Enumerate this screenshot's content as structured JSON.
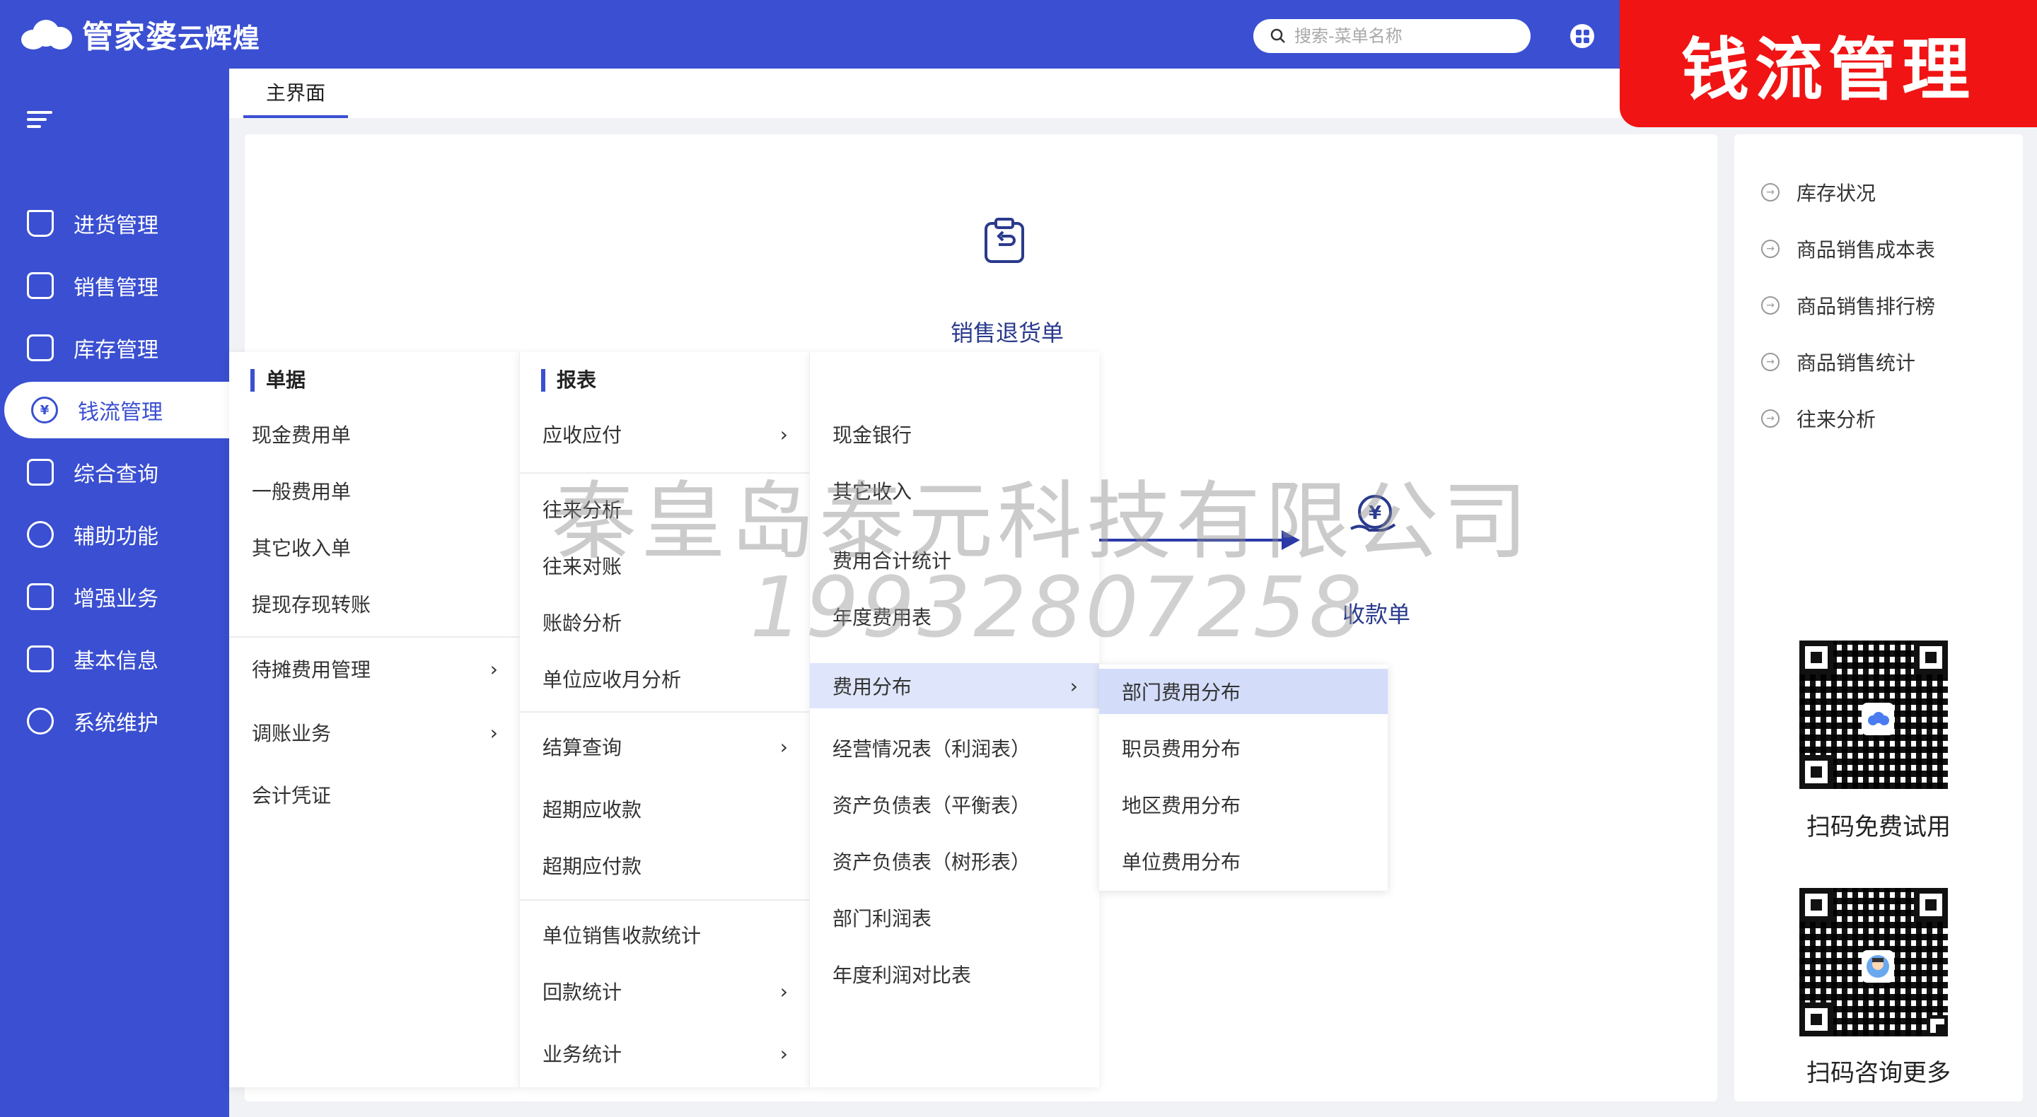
{
  "header": {
    "brand": "管家婆",
    "brand_sub": "云辉煌",
    "search_placeholder": "搜索-菜单名称",
    "badge": "钱流管理",
    "accent": "#3a4fd1",
    "badge_color": "#f01414"
  },
  "sidebar": {
    "items": [
      {
        "label": "进货管理",
        "icon": "cart-icon"
      },
      {
        "label": "销售管理",
        "icon": "sales-chart-icon"
      },
      {
        "label": "库存管理",
        "icon": "box-icon"
      },
      {
        "label": "钱流管理",
        "icon": "yen-bag-icon",
        "active": true
      },
      {
        "label": "综合查询",
        "icon": "search-frame-icon"
      },
      {
        "label": "辅助功能",
        "icon": "hexagon-icon"
      },
      {
        "label": "增强业务",
        "icon": "list-icon"
      },
      {
        "label": "基本信息",
        "icon": "document-icon"
      },
      {
        "label": "系统维护",
        "icon": "users-icon"
      }
    ]
  },
  "tabs": [
    {
      "label": "主界面"
    }
  ],
  "main": {
    "card_return": "销售退货单",
    "card_receipt": "收款单"
  },
  "watermark": {
    "company": "秦皇岛泰元科技有限公司",
    "phone": "19932807258"
  },
  "menu": {
    "col1": {
      "header": "单据",
      "items": [
        "现金费用单",
        "一般费用单",
        "其它收入单",
        "提现存现转账"
      ],
      "items2": [
        "待摊费用管理",
        "调账业务",
        "会计凭证"
      ]
    },
    "col2": {
      "header": "报表",
      "group1": [
        "应收应付"
      ],
      "group2": [
        "往来分析",
        "往来对账",
        "账龄分析",
        "单位应收月分析"
      ],
      "group3": [
        "结算查询",
        "超期应收款",
        "超期应付款"
      ],
      "group4": [
        "单位销售收款统计",
        "回款统计",
        "业务统计"
      ]
    },
    "col3": {
      "items": [
        "现金银行",
        "其它收入",
        "费用合计统计",
        "年度费用表",
        "费用分布",
        "经营情况表（利润表）",
        "资产负债表（平衡表）",
        "资产负债表（树形表）",
        "部门利润表",
        "年度利润对比表"
      ]
    },
    "col4": {
      "items": [
        "部门费用分布",
        "职员费用分布",
        "地区费用分布",
        "单位费用分布"
      ]
    }
  },
  "right_panel": {
    "quick_links": [
      "库存状况",
      "商品销售成本表",
      "商品销售排行榜",
      "商品销售统计",
      "往来分析"
    ],
    "qr1_caption": "扫码免费试用",
    "qr2_caption": "扫码咨询更多"
  }
}
